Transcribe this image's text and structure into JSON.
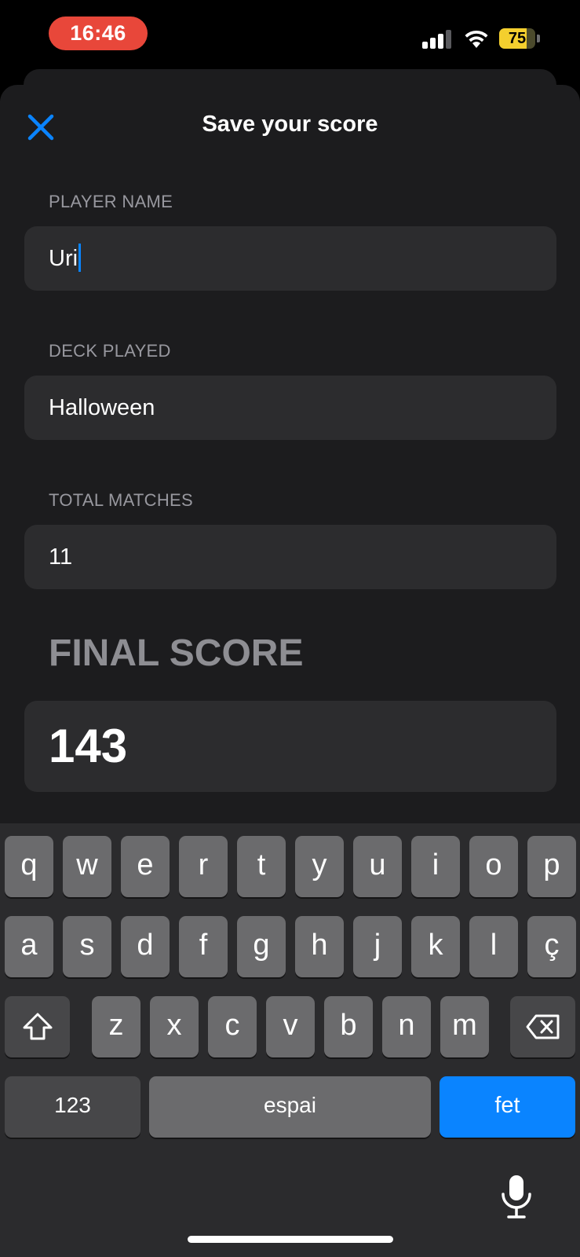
{
  "status_bar": {
    "time": "16:46",
    "battery_level": "75",
    "battery_fraction": 0.75,
    "colors": {
      "time_pill": "#e8473a",
      "battery": "#f4cf2e"
    }
  },
  "sheet": {
    "title": "Save your score",
    "close_icon": "close-x-icon",
    "accent_color": "#0a84ff"
  },
  "form": {
    "player_name": {
      "label": "PLAYER NAME",
      "value": "Uri"
    },
    "deck_played": {
      "label": "DECK PLAYED",
      "value": "Halloween"
    },
    "total_matches": {
      "label": "TOTAL MATCHES",
      "value": "11"
    },
    "final_score": {
      "label": "FINAL SCORE",
      "value": "143"
    }
  },
  "keyboard": {
    "row1": [
      "q",
      "w",
      "e",
      "r",
      "t",
      "y",
      "u",
      "i",
      "o",
      "p"
    ],
    "row2": [
      "a",
      "s",
      "d",
      "f",
      "g",
      "h",
      "j",
      "k",
      "l",
      "ç"
    ],
    "row3": [
      "z",
      "x",
      "c",
      "v",
      "b",
      "n",
      "m"
    ],
    "numbers_key": "123",
    "space_key": "espai",
    "done_key": "fet",
    "icons": {
      "shift": "shift-icon",
      "delete": "delete-icon",
      "dictation": "microphone-icon"
    }
  }
}
